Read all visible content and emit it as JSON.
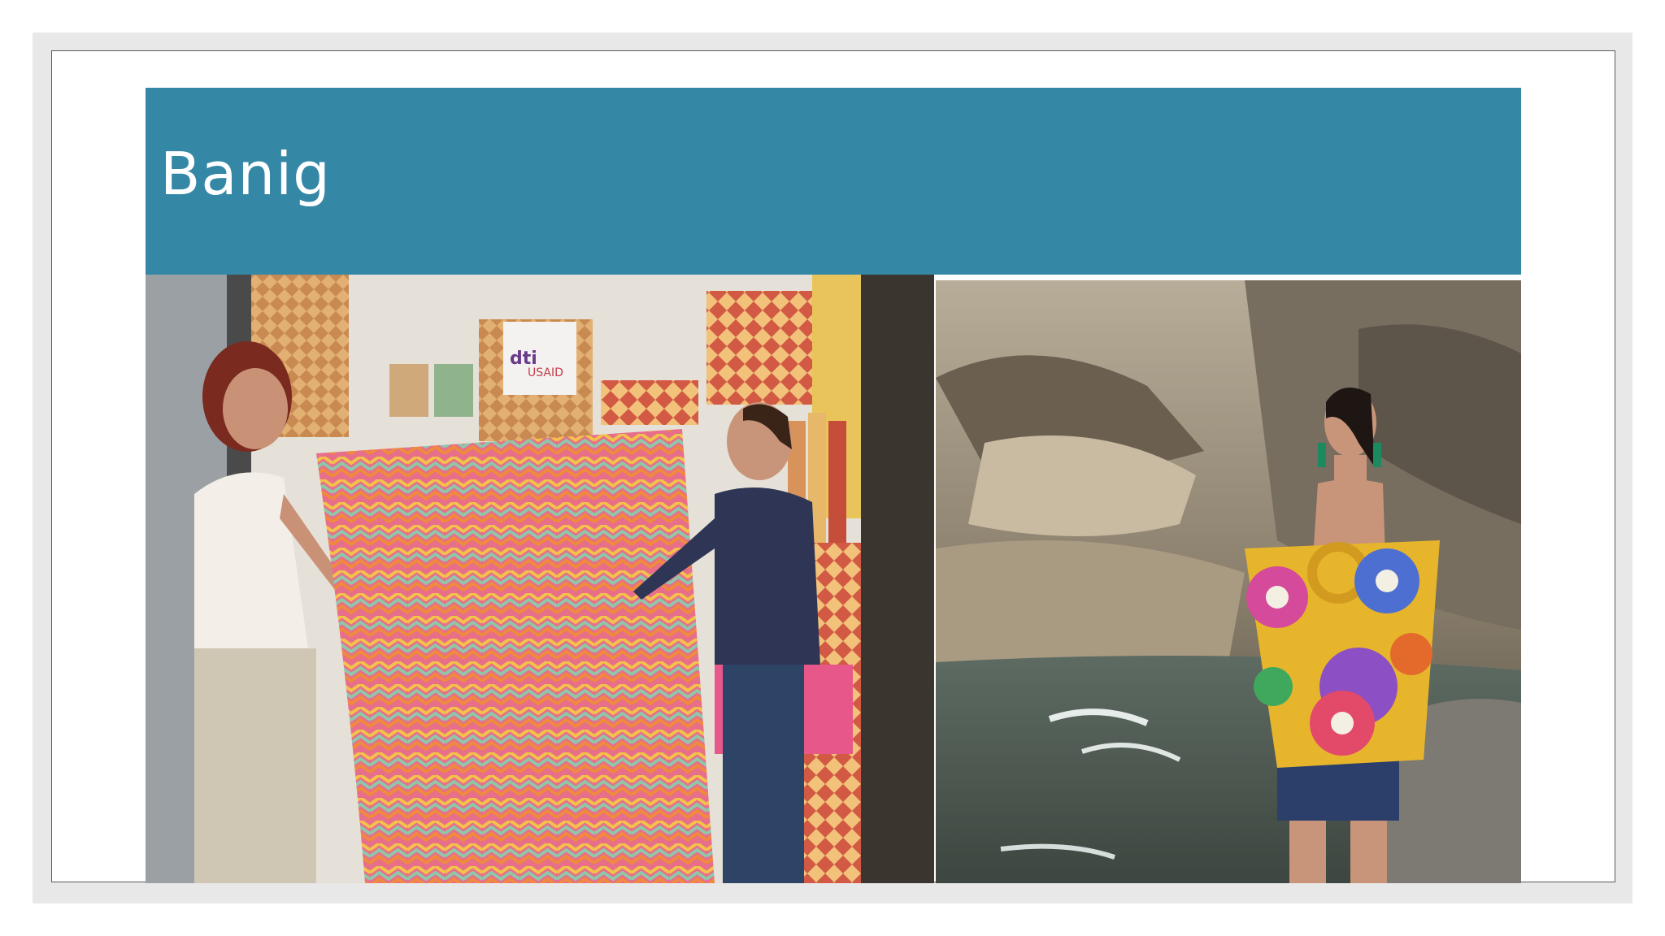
{
  "slide": {
    "title": "Banig"
  },
  "images": {
    "left": {
      "name": "banig-booth-photo",
      "booth_sign_lines": [
        "dti",
        "USAID"
      ]
    },
    "right": {
      "name": "woven-bag-model-photo"
    }
  },
  "colors": {
    "title_bar": "#3587a6",
    "title_text": "#ffffff",
    "viewer_background": "#e8e8e8",
    "slide_background": "#ffffff"
  }
}
